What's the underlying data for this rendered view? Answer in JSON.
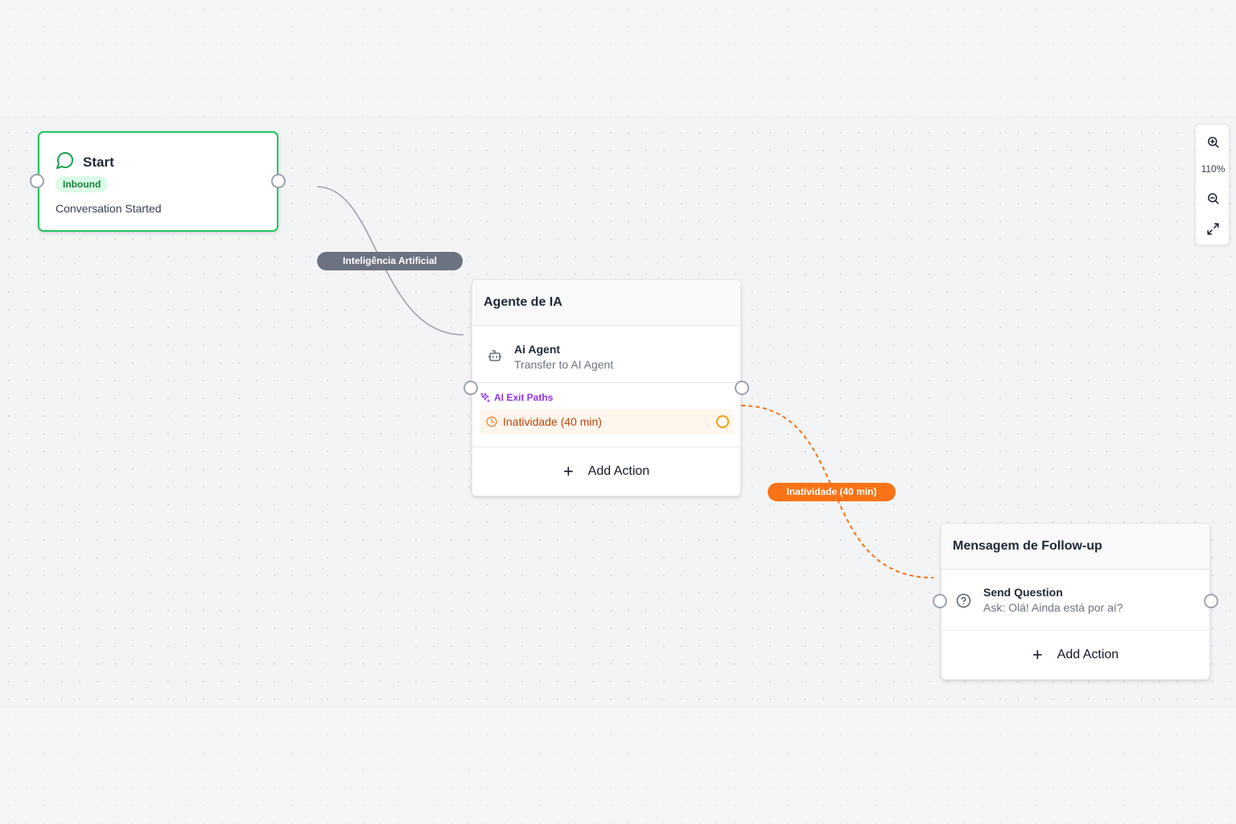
{
  "start_node": {
    "title": "Start",
    "badge": "Inbound",
    "description": "Conversation Started",
    "icon": "chat-bubble-icon",
    "accent": "#22c55e"
  },
  "edges": {
    "ia_label": "Inteligência Artificial",
    "inactivity_label": "Inatividade (40 min)",
    "ia_color": "#9ca3af",
    "inactivity_color": "#f97316"
  },
  "agent_node": {
    "header": "Agente de IA",
    "action": {
      "title": "Ai Agent",
      "subtitle": "Transfer to AI Agent",
      "icon": "robot-icon"
    },
    "exit_paths": {
      "label": "AI Exit Paths",
      "icon": "sparkles-icon",
      "items": [
        {
          "label": "Inatividade (40 min)",
          "icon": "clock-icon"
        }
      ]
    },
    "add_action": "Add Action"
  },
  "follow_node": {
    "header": "Mensagem de Follow-up",
    "action": {
      "title": "Send Question",
      "subtitle": "Ask: Olá! Ainda está por aí?",
      "icon": "question-circle-icon"
    },
    "add_action": "Add Action"
  },
  "zoom": {
    "level": "110%",
    "zoom_in_icon": "zoom-in-icon",
    "zoom_out_icon": "zoom-out-icon",
    "fit_icon": "expand-icon"
  }
}
